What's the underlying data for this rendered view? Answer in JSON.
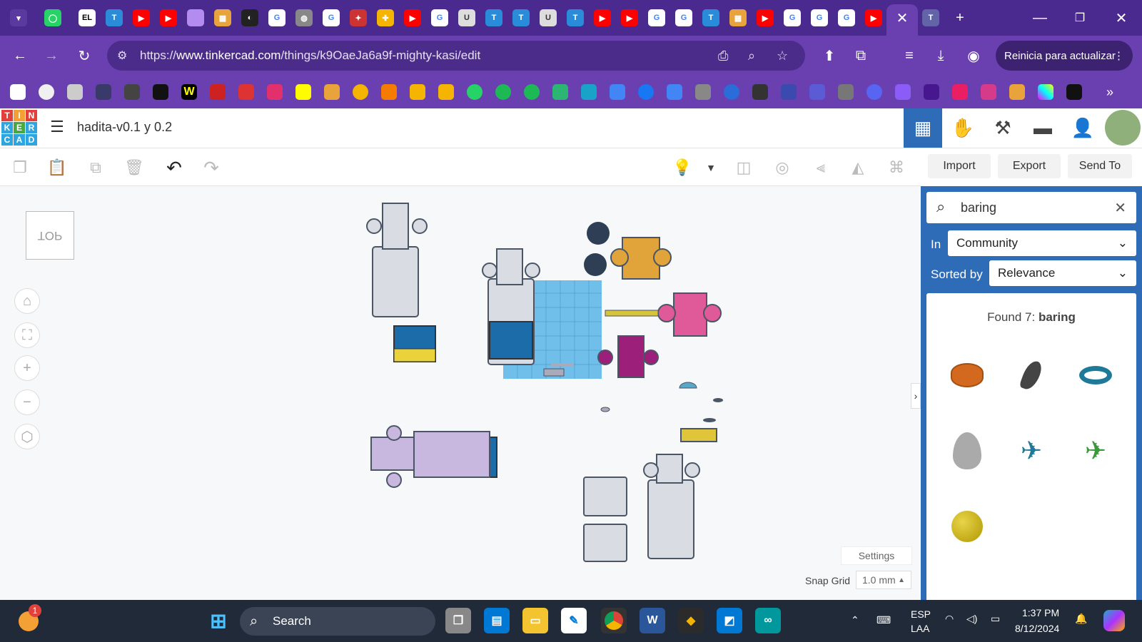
{
  "browser": {
    "url_prefix": "https://",
    "url_domain": "www.tinkercad.com",
    "url_path": "/things/k9OaeJa6a9f-mighty-kasi/edit",
    "update_button": "Reinicia para actualizar"
  },
  "app": {
    "title": "hadita-v0.1 y 0.2",
    "logo_letters": [
      "T",
      "I",
      "N",
      "K",
      "E",
      "R",
      "C",
      "A",
      "D"
    ]
  },
  "toolbar": {
    "import_label": "Import",
    "export_label": "Export",
    "sendto_label": "Send To"
  },
  "viewcube_label": "TOP",
  "workplane": {
    "settings_label": "Settings",
    "snap_label": "Snap Grid",
    "snap_value": "1.0 mm"
  },
  "panel": {
    "search_value": "baring",
    "in_label": "In",
    "in_value": "Community",
    "sort_label": "Sorted by",
    "sort_value": "Relevance",
    "found_prefix": "Found 7:",
    "found_query": "baring",
    "results": [
      {
        "name": "orange-cylinder",
        "color": "#d2691e"
      },
      {
        "name": "dark-wing",
        "color": "#444"
      },
      {
        "name": "teal-torus",
        "color": "#1f7a9a"
      },
      {
        "name": "gray-cone",
        "color": "#aaa"
      },
      {
        "name": "teal-plane",
        "color": "#1f7a9a"
      },
      {
        "name": "green-plane",
        "color": "#3a9a3a"
      },
      {
        "name": "yellow-sphere",
        "color": "#c9b400"
      }
    ]
  },
  "taskbar": {
    "search_label": "Search",
    "lang_top": "ESP",
    "lang_bottom": "LAA",
    "time": "1:37 PM",
    "date": "8/12/2024",
    "notification_count": "1"
  },
  "colors": {
    "tab_bar": "#4a2a8e",
    "address_bar": "#6a40b0",
    "panel": "#2e6cb8",
    "accent_blue": "#2e6cb8"
  }
}
